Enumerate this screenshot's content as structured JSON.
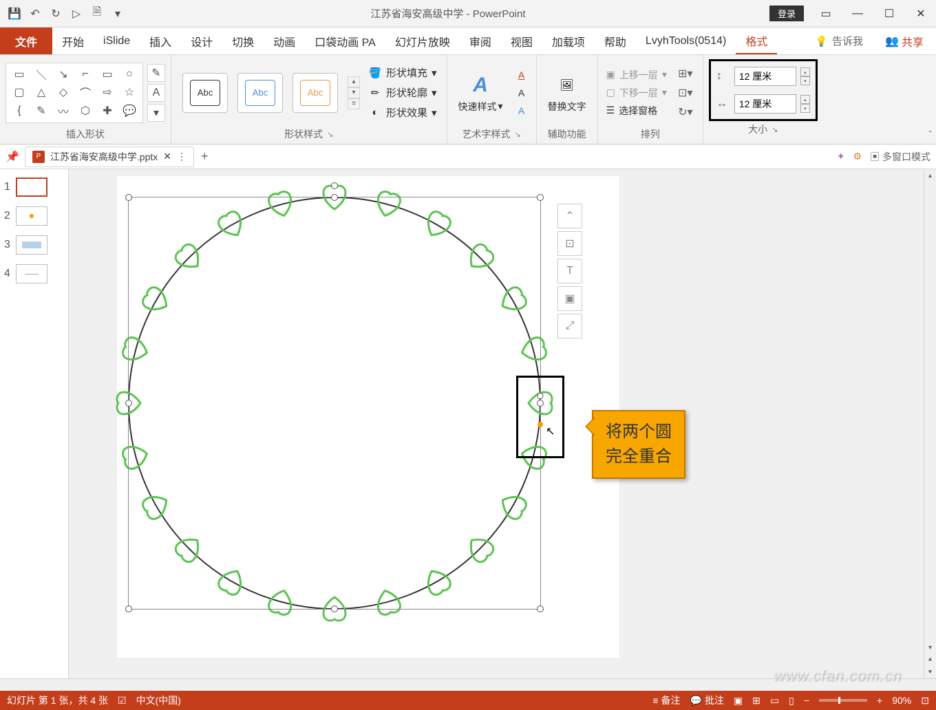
{
  "titlebar": {
    "title": "江苏省海安高级中学 - PowerPoint",
    "login": "登录"
  },
  "tabs": {
    "file": "文件",
    "home": "开始",
    "islide": "iSlide",
    "insert": "插入",
    "design": "设计",
    "transition": "切换",
    "animation": "动画",
    "pocket": "口袋动画 PA",
    "slideshow": "幻灯片放映",
    "review": "审阅",
    "view": "视图",
    "addin": "加载项",
    "help": "帮助",
    "lvyh": "LvyhTools(0514)",
    "format": "格式",
    "tellme": "告诉我",
    "share": "共享"
  },
  "ribbon": {
    "insert_shapes": "插入形状",
    "shape_styles": "形状样式",
    "style_label": "Abc",
    "fill": "形状填充",
    "outline": "形状轮廓",
    "effects": "形状效果",
    "quick_styles": "快速样式",
    "wordart": "艺术字样式",
    "alt_text": "替换文字",
    "acc": "辅助功能",
    "bring_fwd": "上移一层",
    "send_back": "下移一层",
    "sel_pane": "选择窗格",
    "arrange": "排列",
    "size_h": "12 厘米",
    "size_w": "12 厘米",
    "size": "大小"
  },
  "doctab": {
    "name": "江苏省海安高级中学.pptx",
    "multi": "多窗口模式"
  },
  "callout": {
    "line1": "将两个圆",
    "line2": "完全重合"
  },
  "statusbar": {
    "slide": "幻灯片 第 1 张，共 4 张",
    "lang": "中文(中国)",
    "notes": "备注",
    "comments": "批注",
    "zoom": "90%"
  },
  "watermark": "www.cfan.com.cn"
}
